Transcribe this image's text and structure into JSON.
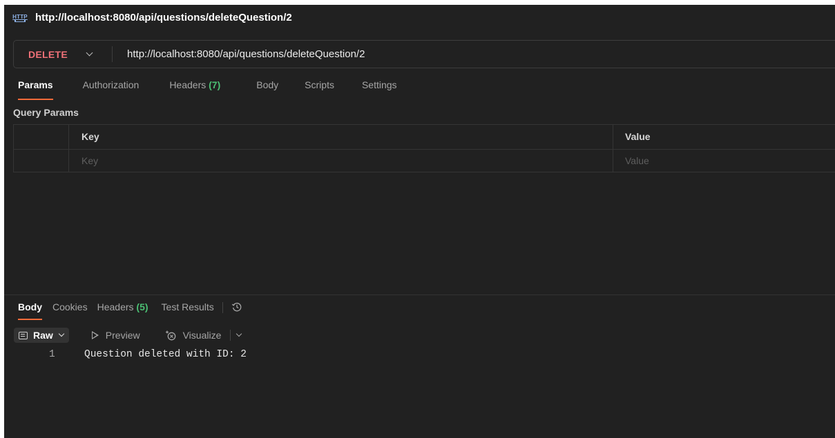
{
  "title": {
    "icon": "http-icon",
    "icon_text": "HTTP",
    "text": "http://localhost:8080/api/questions/deleteQuestion/2"
  },
  "request": {
    "method": "DELETE",
    "url": "http://localhost:8080/api/questions/deleteQuestion/2"
  },
  "request_tabs": [
    {
      "label": "Params",
      "count": ""
    },
    {
      "label": "Authorization",
      "count": ""
    },
    {
      "label": "Headers",
      "count": "(7)"
    },
    {
      "label": "Body",
      "count": ""
    },
    {
      "label": "Scripts",
      "count": ""
    },
    {
      "label": "Settings",
      "count": ""
    }
  ],
  "query_params": {
    "section_label": "Query Params",
    "columns": {
      "key": "Key",
      "value": "Value"
    },
    "placeholders": {
      "key": "Key",
      "value": "Value"
    }
  },
  "response_tabs": [
    {
      "label": "Body",
      "count": ""
    },
    {
      "label": "Cookies",
      "count": ""
    },
    {
      "label": "Headers",
      "count": "(5)"
    },
    {
      "label": "Test Results",
      "count": ""
    }
  ],
  "response_toolbar": {
    "raw": "Raw",
    "preview": "Preview",
    "visualize": "Visualize"
  },
  "response_body": {
    "lines": [
      {
        "number": "1",
        "text": "Question deleted with ID: 2"
      }
    ]
  },
  "colors": {
    "background": "#212121",
    "method_delete": "#f07178",
    "active_tab_underline": "#f26b3a",
    "count_green": "#4bbf73"
  }
}
